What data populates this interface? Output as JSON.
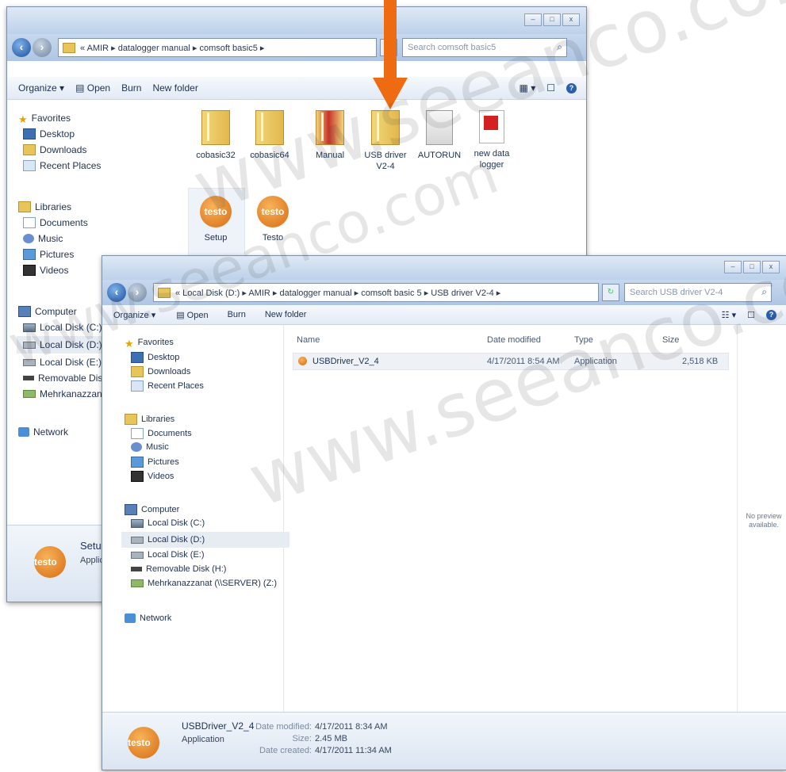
{
  "window1": {
    "address_path": "« AMIR ▸ datalogger manual ▸ comsoft basic5 ▸",
    "search_placeholder": "Search comsoft basic5",
    "toolbar": {
      "organize": "Organize ▾",
      "open": "Open",
      "burn": "Burn",
      "new_folder": "New folder"
    },
    "nav": {
      "favorites": "Favorites",
      "desktop": "Desktop",
      "downloads": "Downloads",
      "recent": "Recent Places",
      "libraries": "Libraries",
      "documents": "Documents",
      "music": "Music",
      "pictures": "Pictures",
      "videos": "Videos",
      "computer": "Computer",
      "c": "Local Disk (C:)",
      "d": "Local Disk (D:)",
      "e": "Local Disk (E:)",
      "removable": "Removable Disk",
      "mehr": "Mehrkanazzanat",
      "network": "Network"
    },
    "files": [
      {
        "name": "cobasic32",
        "icon": "folder-icon"
      },
      {
        "name": "cobasic64",
        "icon": "folder-icon"
      },
      {
        "name": "Manual",
        "icon": "folder-icon"
      },
      {
        "name": "USB driver\nV2-4",
        "icon": "folder-icon"
      },
      {
        "name": "AUTORUN",
        "icon": "setup-file-icon"
      },
      {
        "name": "new data\nlogger",
        "icon": "pdf-icon"
      },
      {
        "name": "Setup",
        "icon": "testo-icon"
      },
      {
        "name": "Testo",
        "icon": "testo-icon"
      }
    ],
    "details": {
      "name": "Setup",
      "type": "Applic"
    }
  },
  "window2": {
    "address_path": "« Local Disk (D:) ▸ AMIR ▸ datalogger manual ▸ comsoft basic 5 ▸ USB driver V2-4 ▸",
    "search_placeholder": "Search USB driver V2-4",
    "toolbar": {
      "organize": "Organize ▾",
      "open": "Open",
      "burn": "Burn",
      "new_folder": "New folder"
    },
    "nav": {
      "favorites": "Favorites",
      "desktop": "Desktop",
      "downloads": "Downloads",
      "recent": "Recent Places",
      "libraries": "Libraries",
      "documents": "Documents",
      "music": "Music",
      "pictures": "Pictures",
      "videos": "Videos",
      "computer": "Computer",
      "c": "Local Disk (C:)",
      "d": "Local Disk (D:)",
      "e": "Local Disk (E:)",
      "removable": "Removable Disk (H:)",
      "mehr": "Mehrkanazzanat (\\\\SERVER) (Z:)",
      "network": "Network"
    },
    "columns": {
      "name": "Name",
      "date": "Date modified",
      "type": "Type",
      "size": "Size"
    },
    "row": {
      "name": "USBDriver_V2_4",
      "date": "4/17/2011 8:54 AM",
      "type": "Application",
      "size": "2,518 KB"
    },
    "preview": "No preview available.",
    "details": {
      "name": "USBDriver_V2_4",
      "type": "Application",
      "modified_label": "Date modified:",
      "modified": "4/17/2011 8:34 AM",
      "size_label": "Size:",
      "size": "2.45 MB",
      "created_label": "Date created:",
      "created": "4/17/2011 11:34 AM"
    }
  },
  "watermarks": [
    "www.seeanco.com",
    "www.seeanco.com",
    "www.seeanco.com"
  ],
  "colors": {
    "arrow": "#ef6b12",
    "accent": "#2a5fb0"
  }
}
